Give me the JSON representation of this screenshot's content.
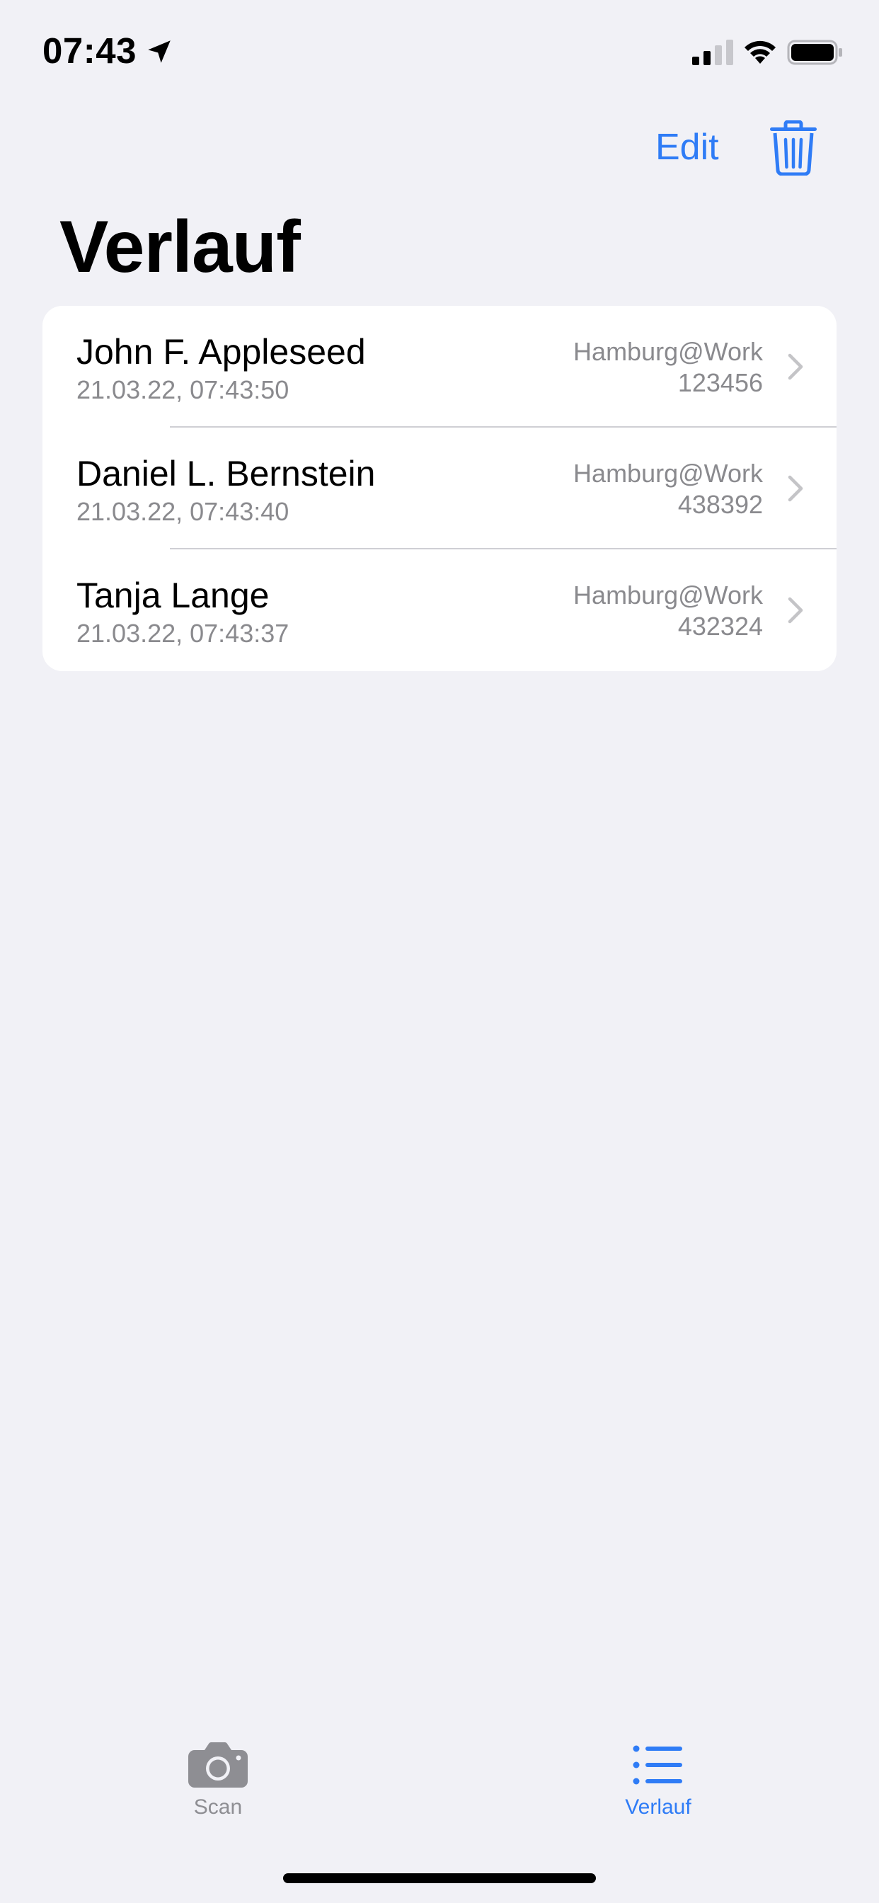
{
  "status_bar": {
    "time": "07:43"
  },
  "nav": {
    "edit_label": "Edit",
    "title": "Verlauf"
  },
  "history": {
    "items": [
      {
        "name": "John F. Appleseed",
        "timestamp": "21.03.22, 07:43:50",
        "location": "Hamburg@Work",
        "number": "123456"
      },
      {
        "name": "Daniel L. Bernstein",
        "timestamp": "21.03.22, 07:43:40",
        "location": "Hamburg@Work",
        "number": "438392"
      },
      {
        "name": "Tanja Lange",
        "timestamp": "21.03.22, 07:43:37",
        "location": "Hamburg@Work",
        "number": "432324"
      }
    ]
  },
  "tab_bar": {
    "tabs": [
      {
        "label": "Scan",
        "icon": "camera-icon",
        "active": false
      },
      {
        "label": "Verlauf",
        "icon": "list-icon",
        "active": true
      }
    ]
  },
  "colors": {
    "accent": "#2f7cf6",
    "background": "#f1f1f6",
    "secondary_text": "#8a8a8e",
    "inactive_tab": "#8e8e93"
  }
}
